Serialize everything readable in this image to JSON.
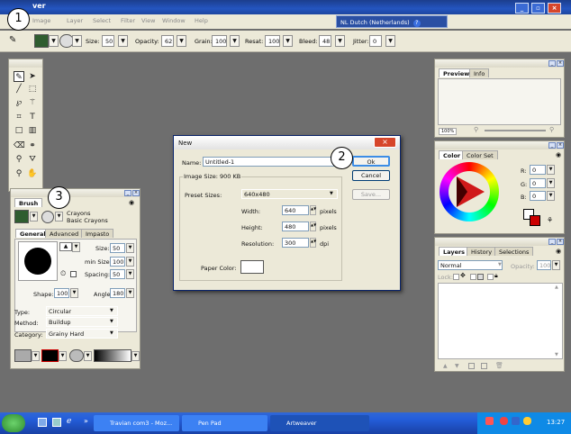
{
  "app": {
    "title": "ver"
  },
  "language_bar": {
    "label": "NL Dutch (Netherlands)"
  },
  "menu": [
    "Image",
    "Layer",
    "Select",
    "Filter",
    "View",
    "Window",
    "Help"
  ],
  "toolbar": {
    "size_label": "Size:",
    "size": "50",
    "opacity_label": "Opacity:",
    "opacity": "62",
    "grain_label": "Grain:",
    "grain": "100",
    "resat_label": "Resat:",
    "resat": "100",
    "bleed_label": "Bleed:",
    "bleed": "48",
    "jitter_label": "Jitter:",
    "jitter": "0"
  },
  "callouts": [
    "1",
    "2",
    "3"
  ],
  "preview_panel": {
    "tabs": [
      "Preview",
      "Info"
    ],
    "zoom": "100%"
  },
  "color_panel": {
    "tabs": [
      "Color",
      "Color Set"
    ],
    "r_label": "R:",
    "g_label": "G:",
    "b_label": "B:",
    "r": "0",
    "g": "0",
    "b": "0",
    "colors": {
      "fg": "#ffffff",
      "bg": "#cc0000"
    }
  },
  "layers_panel": {
    "tabs": [
      "Layers",
      "History",
      "Selections"
    ],
    "blend_mode": "Normal",
    "opacity_label": "Opacity:",
    "opacity": "100",
    "lock_label": "Lock:"
  },
  "brush_panel": {
    "tabs": [
      "Brush"
    ],
    "brush_category": "Crayons",
    "brush_name": "Basic Crayons",
    "subtabs": [
      "General",
      "Advanced",
      "Impasto"
    ],
    "size_label": "Size:",
    "size": "50",
    "min_size_label": "min Size:",
    "min_size": "100",
    "spacing_label": "Spacing:",
    "spacing": "50",
    "shape_label": "Shape:",
    "shape": "100",
    "angle_label": "Angle:",
    "angle": "180",
    "type_label": "Type:",
    "type": "Circular",
    "method_label": "Method:",
    "method": "Buildup",
    "category_label": "Category:",
    "category": "Grainy Hard"
  },
  "new_dialog": {
    "title": "New",
    "name_label": "Name:",
    "name_value": "Untitled-1",
    "image_size": "Image Size: 900 KB",
    "preset_label": "Preset Sizes:",
    "preset_value": "640x480",
    "width_label": "Width:",
    "width": "640",
    "width_unit": "pixels",
    "height_label": "Height:",
    "height": "480",
    "height_unit": "pixels",
    "resolution_label": "Resolution:",
    "resolution": "300",
    "resolution_unit": "dpi",
    "paper_color_label": "Paper Color:",
    "ok": "Ok",
    "cancel": "Cancel",
    "save": "Save...",
    "close_glyph": "×"
  },
  "taskbar": {
    "tasks": [
      "Travian com3 - Moz...",
      "Pen Pad",
      "Artweaver"
    ],
    "clock": "13:27",
    "expand_glyph": "»"
  },
  "colors": {
    "accent": "#245edb",
    "close_red": "#d6452a"
  }
}
